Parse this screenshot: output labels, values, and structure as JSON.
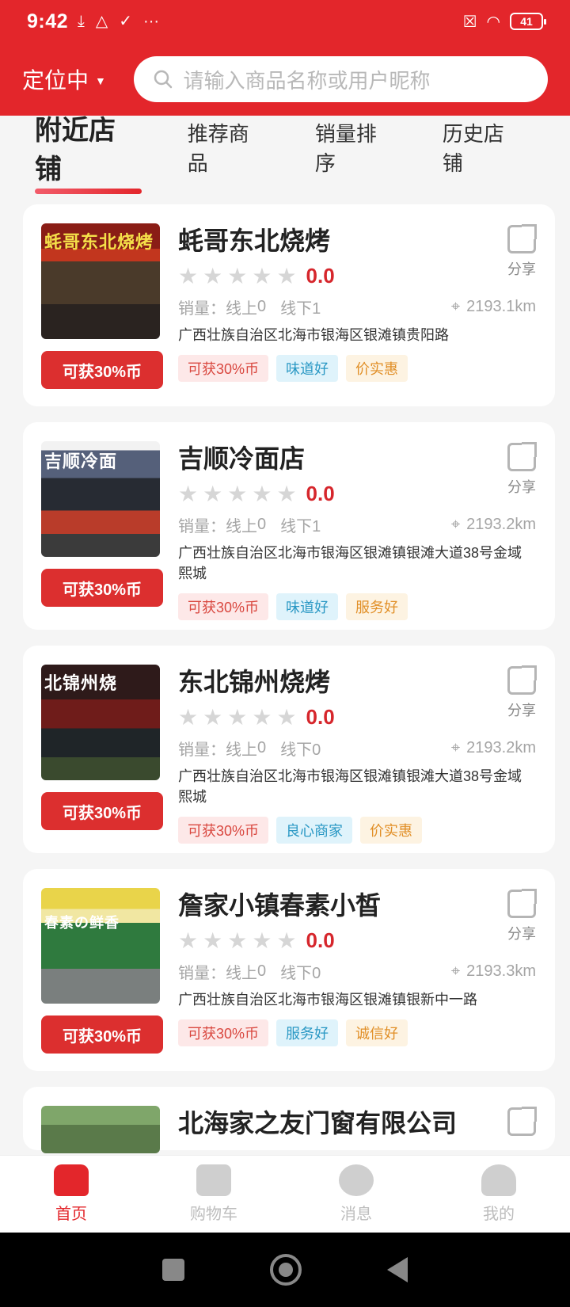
{
  "status": {
    "time": "9:42",
    "battery": "41"
  },
  "header": {
    "location": "定位中",
    "search_placeholder": "请输入商品名称或用户昵称"
  },
  "tabs": [
    "附近店铺",
    "推荐商品",
    "销量排序",
    "历史店铺"
  ],
  "labels": {
    "sales_prefix": "销量：",
    "online_prefix": "线上",
    "offline_prefix": "线下",
    "share": "分享",
    "coin_button": "可获30%币"
  },
  "shops": [
    {
      "name": "蚝哥东北烧烤",
      "score": "0.0",
      "online": "0",
      "offline": "1",
      "distance": "2193.1km",
      "address": "广西壮族自治区北海市银海区银滩镇贵阳路",
      "tags": [
        {
          "text": "可获30%币",
          "color": "red"
        },
        {
          "text": "味道好",
          "color": "blue"
        },
        {
          "text": "价实惠",
          "color": "orange"
        }
      ]
    },
    {
      "name": "吉顺冷面店",
      "score": "0.0",
      "online": "0",
      "offline": "1",
      "distance": "2193.2km",
      "address": "广西壮族自治区北海市银海区银滩镇银滩大道38号金域熙城",
      "tags": [
        {
          "text": "可获30%币",
          "color": "red"
        },
        {
          "text": "味道好",
          "color": "blue"
        },
        {
          "text": "服务好",
          "color": "orange"
        }
      ]
    },
    {
      "name": "东北锦州烧烤",
      "score": "0.0",
      "online": "0",
      "offline": "0",
      "distance": "2193.2km",
      "address": "广西壮族自治区北海市银海区银滩镇银滩大道38号金域熙城",
      "tags": [
        {
          "text": "可获30%币",
          "color": "red"
        },
        {
          "text": "良心商家",
          "color": "blue"
        },
        {
          "text": "价实惠",
          "color": "orange"
        }
      ]
    },
    {
      "name": "詹家小镇春素小皙",
      "score": "0.0",
      "online": "0",
      "offline": "0",
      "distance": "2193.3km",
      "address": "广西壮族自治区北海市银海区银滩镇银新中一路",
      "tags": [
        {
          "text": "可获30%币",
          "color": "red"
        },
        {
          "text": "服务好",
          "color": "blue"
        },
        {
          "text": "诚信好",
          "color": "orange"
        }
      ]
    },
    {
      "name": "北海家之友门窗有限公司"
    }
  ],
  "bottom_nav": [
    "首页",
    "购物车",
    "消息",
    "我的"
  ],
  "colors": {
    "brand": "#e3262b",
    "accent_score": "#d6262c"
  }
}
